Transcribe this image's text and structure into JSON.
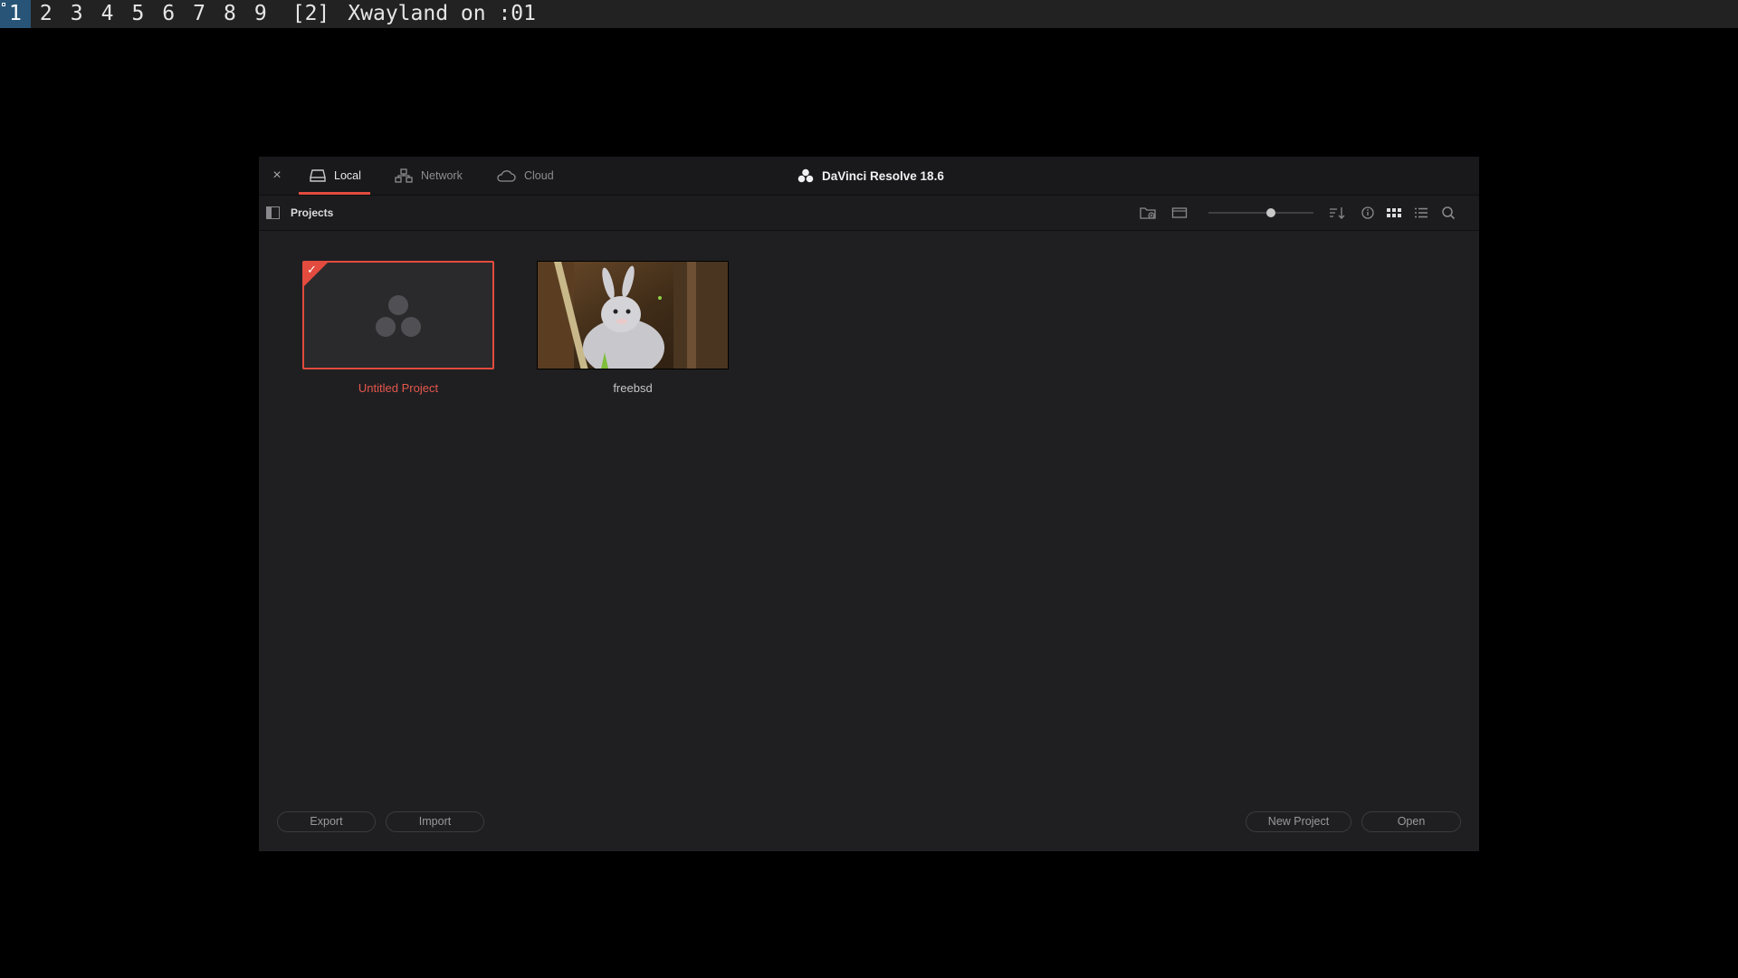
{
  "wm_bar": {
    "workspaces": [
      "1",
      "2",
      "3",
      "4",
      "5",
      "6",
      "7",
      "8",
      "9"
    ],
    "active_workspace": "1",
    "tag": "[2]",
    "window_title": "Xwayland on :01"
  },
  "dialog": {
    "close_glyph": "×",
    "tabs": [
      {
        "label": "Local",
        "icon": "drive-icon",
        "active": true
      },
      {
        "label": "Network",
        "icon": "network-icon",
        "active": false
      },
      {
        "label": "Cloud",
        "icon": "cloud-icon",
        "active": false
      }
    ],
    "app_title": "DaVinci Resolve 18.6",
    "breadcrumb": "Projects",
    "toolbar_icons": [
      "add-folder-icon",
      "frame-icon",
      "zoom-slider",
      "sort-icon",
      "info-icon",
      "grid-view-icon",
      "list-view-icon",
      "search-icon"
    ],
    "zoom_level": 0.6,
    "projects": [
      {
        "name": "Untitled Project",
        "selected": true
      },
      {
        "name": "freebsd",
        "selected": false
      }
    ],
    "buttons": {
      "export": "Export",
      "import": "Import",
      "new_project": "New Project",
      "open": "Open"
    }
  },
  "colors": {
    "accent": "#e34b3e",
    "background": "#1f1f22",
    "workspace_active": "#285577"
  }
}
